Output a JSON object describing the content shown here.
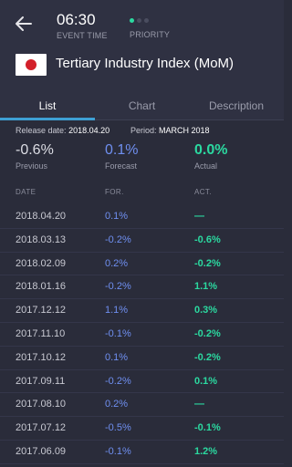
{
  "header": {
    "time": "06:30",
    "time_label": "EVENT TIME",
    "priority_label": "PRIORITY",
    "title": "Tertiary Industry Index (MoM)"
  },
  "tabs": [
    "List",
    "Chart",
    "Description"
  ],
  "info": {
    "release_label": "Release date:",
    "release_value": "2018.04.20",
    "period_label": "Period:",
    "period_value": "MARCH 2018"
  },
  "summary": {
    "previous": {
      "value": "-0.6%",
      "label": "Previous"
    },
    "forecast": {
      "value": "0.1%",
      "label": "Forecast"
    },
    "actual": {
      "value": "0.0%",
      "label": "Actual"
    }
  },
  "columns": {
    "date": "DATE",
    "for": "FOR.",
    "act": "ACT."
  },
  "rows": [
    {
      "date": "2018.04.20",
      "for": "0.1%",
      "act": "—"
    },
    {
      "date": "2018.03.13",
      "for": "-0.2%",
      "act": "-0.6%"
    },
    {
      "date": "2018.02.09",
      "for": "0.2%",
      "act": "-0.2%"
    },
    {
      "date": "2018.01.16",
      "for": "-0.2%",
      "act": "1.1%"
    },
    {
      "date": "2017.12.12",
      "for": "1.1%",
      "act": "0.3%"
    },
    {
      "date": "2017.11.10",
      "for": "-0.1%",
      "act": "-0.2%"
    },
    {
      "date": "2017.10.12",
      "for": "0.1%",
      "act": "-0.2%"
    },
    {
      "date": "2017.09.11",
      "for": "-0.2%",
      "act": "0.1%"
    },
    {
      "date": "2017.08.10",
      "for": "0.2%",
      "act": "—"
    },
    {
      "date": "2017.07.12",
      "for": "-0.5%",
      "act": "-0.1%"
    },
    {
      "date": "2017.06.09",
      "for": "-0.1%",
      "act": "1.2%"
    }
  ]
}
